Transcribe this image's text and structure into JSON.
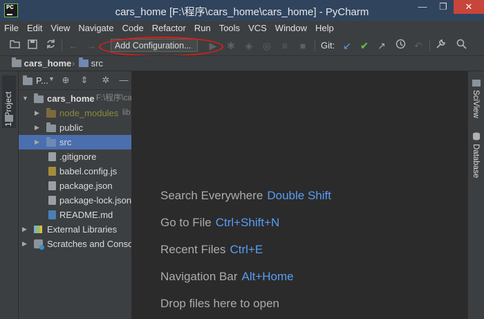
{
  "window": {
    "title": "cars_home [F:\\程序\\cars_home\\cars_home] - PyCharm",
    "app_icon_text": "PC",
    "controls": [
      "—",
      "❐",
      "✕"
    ]
  },
  "menu": [
    "File",
    "Edit",
    "View",
    "Navigate",
    "Code",
    "Refactor",
    "Run",
    "Tools",
    "VCS",
    "Window",
    "Help"
  ],
  "toolbar": {
    "add_configuration_label": "Add Configuration...",
    "git_label": "Git:",
    "icons": [
      "open-folder-icon",
      "save-icon",
      "sync-icon",
      "back-icon",
      "forward-icon",
      "run-icon",
      "debug-icon",
      "coverage-icon",
      "profile-icon",
      "concurrency-icon",
      "stop-icon",
      "vcs-update-icon",
      "vcs-commit-icon",
      "vcs-push-icon",
      "history-icon",
      "rollback-icon",
      "settings-wrench-icon",
      "search-icon"
    ],
    "highlight_color": "#e11d16"
  },
  "breadcrumb": {
    "items": [
      "cars_home",
      "src"
    ]
  },
  "left_stripe": {
    "project_tab": "1: Project"
  },
  "project_panel": {
    "view_selector": "P...",
    "tree": [
      {
        "label": "cars_home",
        "extra": "F:\\程序\\ca",
        "icon": "folder"
      },
      {
        "label": "node_modules",
        "extra": "lib",
        "icon": "folder-excluded"
      },
      {
        "label": "public",
        "icon": "folder"
      },
      {
        "label": "src",
        "icon": "folder-source"
      },
      {
        "label": ".gitignore",
        "icon": "file"
      },
      {
        "label": "babel.config.js",
        "icon": "js-file"
      },
      {
        "label": "package.json",
        "icon": "json-file"
      },
      {
        "label": "package-lock.json",
        "icon": "json-file"
      },
      {
        "label": "README.md",
        "icon": "md-file"
      },
      {
        "label": "External Libraries",
        "icon": "library"
      },
      {
        "label": "Scratches and Conso",
        "icon": "scratch"
      }
    ]
  },
  "editor_hints": [
    {
      "label": "Search Everywhere",
      "key": "Double Shift"
    },
    {
      "label": "Go to File",
      "key": "Ctrl+Shift+N"
    },
    {
      "label": "Recent Files",
      "key": "Ctrl+E"
    },
    {
      "label": "Navigation Bar",
      "key": "Alt+Home"
    },
    {
      "label": "Drop files here to open",
      "key": ""
    }
  ],
  "right_stripe": {
    "tabs": [
      "SciView",
      "Database"
    ]
  }
}
